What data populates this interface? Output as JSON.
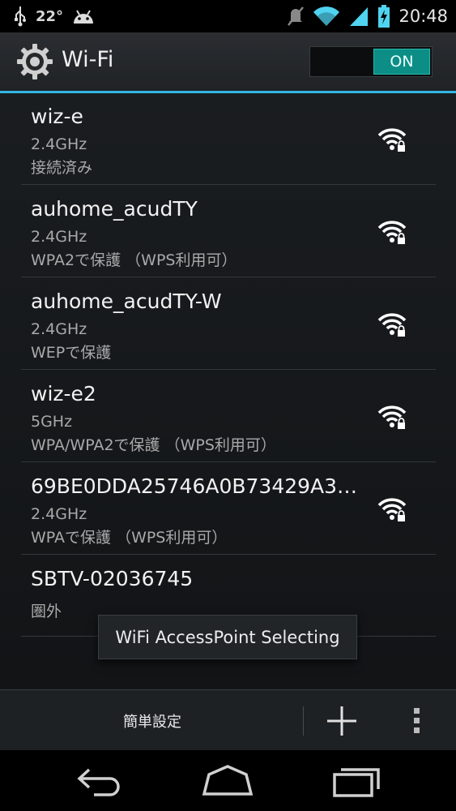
{
  "status_bar": {
    "temperature": "22°",
    "time": "20:48",
    "icons": [
      "usb-icon",
      "android-icon",
      "mute-icon",
      "wifi-signal-icon",
      "cell-signal-icon",
      "battery-charging-icon"
    ]
  },
  "action_bar": {
    "title": "Wi-Fi",
    "toggle_label": "ON",
    "toggle_state": true
  },
  "networks": [
    {
      "ssid": "wiz-e",
      "frequency": "2.4GHz",
      "status": "接続済み",
      "secured": true
    },
    {
      "ssid": "auhome_acudTY",
      "frequency": "2.4GHz",
      "status": "WPA2で保護 （WPS利用可）",
      "secured": true
    },
    {
      "ssid": "auhome_acudTY-W",
      "frequency": "2.4GHz",
      "status": "WEPで保護",
      "secured": true
    },
    {
      "ssid": "wiz-e2",
      "frequency": "5GHz",
      "status": "WPA/WPA2で保護 （WPS利用可）",
      "secured": true
    },
    {
      "ssid": "69BE0DDA25746A0B73429A3…",
      "frequency": "2.4GHz",
      "status": "WPAで保護 （WPS利用可）",
      "secured": true
    },
    {
      "ssid": "SBTV-02036745",
      "frequency": "",
      "status": "圏外",
      "secured": false
    }
  ],
  "toast": {
    "text": "WiFi AccessPoint Selecting"
  },
  "bottom_bar": {
    "easy_setup_label": "簡単設定"
  },
  "colors": {
    "accent": "#33b5e5",
    "toggle_on": "#0c8e86"
  }
}
